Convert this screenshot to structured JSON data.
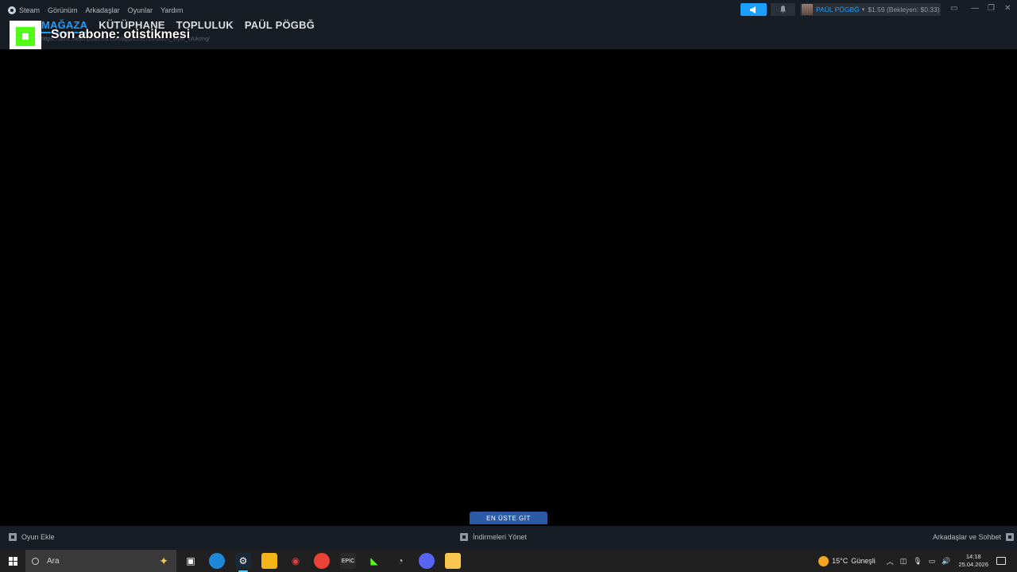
{
  "menu": {
    "items": [
      "Steam",
      "Görünüm",
      "Arkadaşlar",
      "Oyunlar",
      "Yardım"
    ]
  },
  "nav": {
    "tabs": [
      "MAĞAZA",
      "KÜTÜPHANE",
      "TOPLULUK",
      "PAÜL PÖGBĞ"
    ]
  },
  "url": "https://store.steampowered.com/app/2358720/Black_Myth_Wukong/",
  "overlay": {
    "subscriber_text": "Son abone: otistikmesi"
  },
  "account": {
    "name": "PAÜL PÖGBĞ",
    "wallet": "$1.59 (Bekleyen: $0.33)"
  },
  "bottom": {
    "add_game": "Oyun Ekle",
    "downloads": "İndirmeleri Yönet",
    "friends": "Arkadaşlar ve Sohbet",
    "scroll_top": "EN ÜSTE GİT"
  },
  "taskbar": {
    "search_placeholder": "Ara",
    "weather_temp": "15°C",
    "weather_desc": "Güneşli",
    "time": "14:18",
    "date": "25.04.2026"
  },
  "colors": {
    "accent": "#1a9fff",
    "steam_bg": "#171d25",
    "kick_green": "#53fc18"
  }
}
